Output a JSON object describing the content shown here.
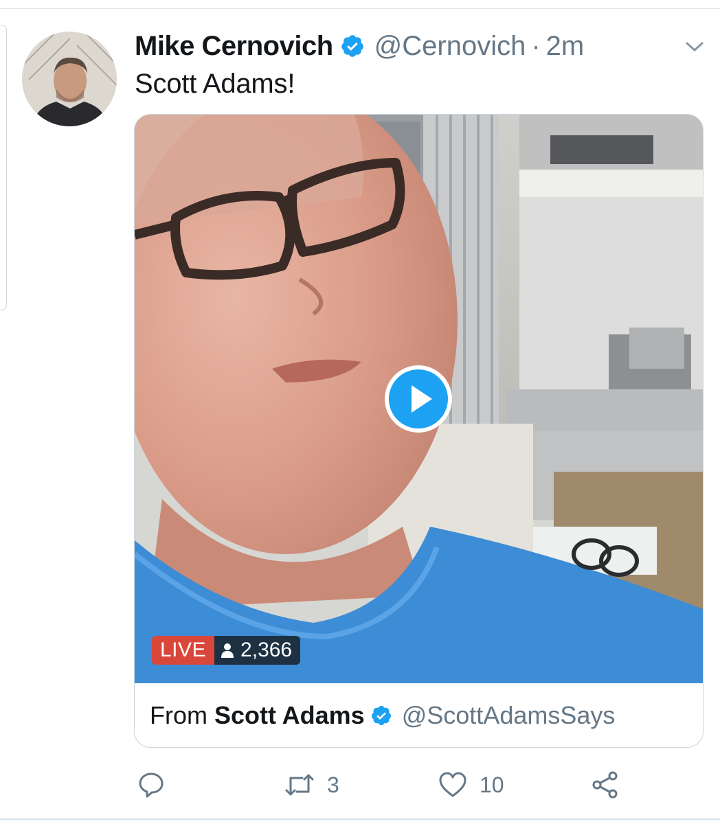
{
  "tweet": {
    "author_name": "Mike Cernovich",
    "author_handle": "@Cernovich",
    "separator": "·",
    "time": "2m",
    "text": "Scott Adams!"
  },
  "video_card": {
    "live_label": "LIVE",
    "viewer_count": "2,366",
    "from_label": "From",
    "source_name": "Scott Adams",
    "source_handle": "@ScottAdamsSays"
  },
  "actions": {
    "reply_count": "",
    "retweet_count": "3",
    "like_count": "10"
  },
  "icons": {
    "verified": "verified-badge-icon",
    "caret": "chevron-down-icon",
    "play": "play-icon",
    "viewers": "person-icon",
    "reply": "reply-icon",
    "retweet": "retweet-icon",
    "like": "heart-icon",
    "share": "share-icon"
  },
  "colors": {
    "accent": "#1da1f2",
    "live": "#d9473a",
    "muted_text": "#657786",
    "text": "#14171a"
  }
}
